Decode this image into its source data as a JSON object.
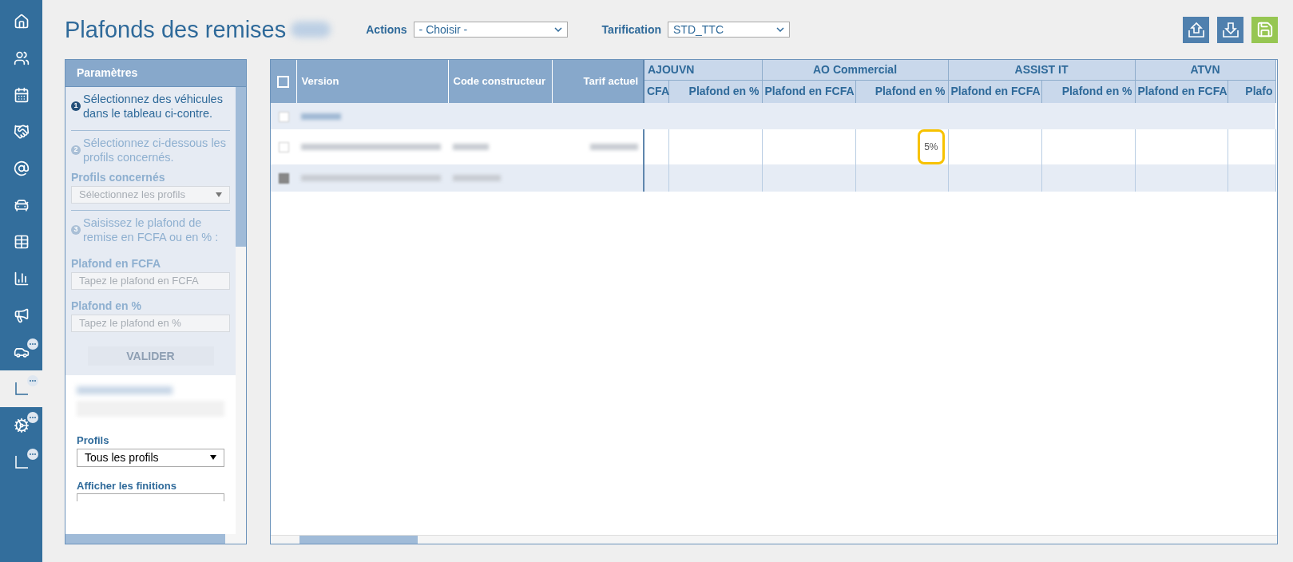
{
  "sidebar": {
    "items": [
      {
        "kind": "home",
        "selected": false,
        "badge": false
      },
      {
        "kind": "people",
        "selected": false,
        "badge": false
      },
      {
        "kind": "calendar",
        "selected": false,
        "badge": false
      },
      {
        "kind": "handshake",
        "selected": false,
        "badge": false
      },
      {
        "kind": "at",
        "selected": false,
        "badge": false
      },
      {
        "kind": "cars",
        "selected": false,
        "badge": false
      },
      {
        "kind": "table",
        "selected": false,
        "badge": false
      },
      {
        "kind": "chart",
        "selected": false,
        "badge": false
      },
      {
        "kind": "megaphone",
        "selected": false,
        "badge": false
      },
      {
        "kind": "car",
        "selected": false,
        "badge": true
      },
      {
        "kind": "corner",
        "selected": true,
        "badge": true
      },
      {
        "kind": "gears",
        "selected": false,
        "badge": true
      },
      {
        "kind": "corner",
        "selected": false,
        "badge": true
      }
    ]
  },
  "page": {
    "title": "Plafonds des remises"
  },
  "toolbar": {
    "actions": {
      "label": "Actions",
      "value": "- Choisir -"
    },
    "pricing": {
      "label": "Tarification",
      "value": "STD_TTC"
    },
    "buttons": [
      {
        "kind": "upload"
      },
      {
        "kind": "download"
      },
      {
        "kind": "save"
      }
    ]
  },
  "parameters": {
    "title": "Paramètres",
    "steps": [
      {
        "number": "1",
        "text": "Sélectionnez des véhicules dans le tableau ci-contre.",
        "disabled": false
      },
      {
        "number": "2",
        "text": "Sélectionnez ci-dessous les profils concernés.",
        "disabled": true
      },
      {
        "number": "3",
        "text": "Saisissez le plafond de remise en FCFA ou en % :",
        "disabled": true
      }
    ],
    "profiles_select": {
      "label": "Profils concernés",
      "placeholder": "Sélectionnez les profils",
      "disabled": true
    },
    "fcfa_field": {
      "label": "Plafond en FCFA",
      "placeholder": "Tapez le plafond en FCFA",
      "disabled": true
    },
    "percent_field": {
      "label": "Plafond en %",
      "placeholder": "Tapez le plafond en %",
      "disabled": true
    },
    "submit": {
      "label": "VALIDER",
      "disabled": true
    }
  },
  "filters": {
    "profiles": {
      "label": "Profils",
      "value": "Tous les profils"
    },
    "finishes": {
      "label": "Afficher les finitions"
    }
  },
  "table": {
    "columns": [
      {
        "label": "Version"
      },
      {
        "label": "Code constructeur"
      },
      {
        "label": "Tarif actuel"
      }
    ],
    "header_checkbox": {
      "checked": false
    },
    "groups": [
      {
        "label": "AJOUVN",
        "subcolumns": [
          "CFA",
          "Plafond en %"
        ]
      },
      {
        "label": "AO Commercial",
        "subcolumns": [
          "Plafond en FCFA",
          "Plafond en %"
        ]
      },
      {
        "label": "ASSIST IT",
        "subcolumns": [
          "Plafond en FCFA",
          "Plafond en %"
        ]
      },
      {
        "label": "ATVN",
        "subcolumns": [
          "Plafond en FCFA",
          "Plafo"
        ]
      }
    ],
    "rows": [
      {
        "kind": "group",
        "checked": false
      },
      {
        "kind": "item",
        "checked": false,
        "cells": [
          {},
          {},
          {},
          {
            "text": "5%",
            "highlighted": true
          },
          {},
          {},
          {},
          {}
        ]
      },
      {
        "kind": "item",
        "checked": true,
        "cells": [
          {},
          {},
          {},
          {},
          {},
          {},
          {},
          {}
        ]
      }
    ]
  }
}
